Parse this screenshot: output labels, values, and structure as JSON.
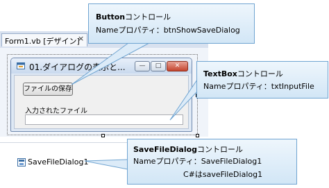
{
  "ide": {
    "tab_label": "Form1.vb [デザイン]",
    "tab_close": "×"
  },
  "form": {
    "title": "01.ダイアログの表示と...",
    "minimize": "—",
    "maximize": "□",
    "close": "✕",
    "save_button": "ファイルの保存",
    "input_label": "入力されたファイル",
    "input_value": ""
  },
  "tray": {
    "component_label": "SaveFileDialog1"
  },
  "callouts": {
    "button": {
      "title_bold": "Button",
      "title_rest": "コントロール",
      "line1": "Nameプロパティ：btnShowSaveDialog"
    },
    "textbox": {
      "title_bold": "TextBox",
      "title_rest": "コントロール",
      "line1": "Nameプロパティ：txtInputFile"
    },
    "dialog": {
      "title_bold": "SaveFileDialog",
      "title_rest": "コントロール",
      "line1": "Nameプロパティ：SaveFileDialog1",
      "line2": "C#はsaveFileDialog1"
    }
  },
  "colors": {
    "callout_border": "#6fa4d1",
    "callout_fill": "#e3f0fa",
    "ide_tab_strip": "#d8e1ef"
  },
  "icons": {
    "form": "form-icon",
    "tray_component": "save-file-dialog-icon"
  }
}
